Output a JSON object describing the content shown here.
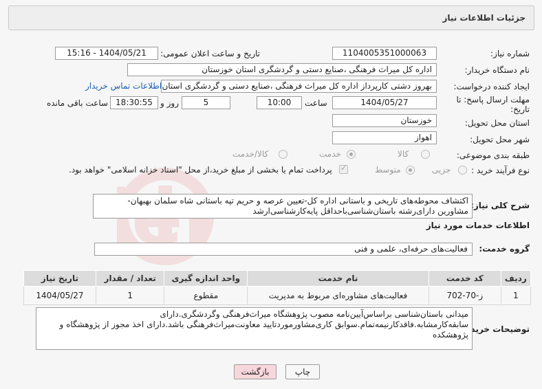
{
  "page_title": "جزئیات اطلاعات نیاز",
  "need_number": {
    "label": "شماره نیاز:",
    "value": "1104005351000063"
  },
  "announce": {
    "label": "تاریخ و ساعت اعلان عمومی:",
    "value": "1404/05/21 - 15:16"
  },
  "buyer_org": {
    "label": "نام دستگاه خریدار:",
    "value": "اداره کل میراث فرهنگی ،صنایع دستی و گردشگری استان خوزستان"
  },
  "requester": {
    "label": "ایجاد کننده درخواست:",
    "value": "بهروز دشتی کارپرداز اداره کل میراث فرهنگی ،صنایع دستی و گردشگری استان خوزستان",
    "contact_link": "اطلاعات تماس خریدار"
  },
  "deadline": {
    "label_line1": "مهلت ارسال پاسخ: تا",
    "label_line2": "تاریخ:",
    "date": "1404/05/27",
    "time_label": "ساعت",
    "time": "10:00",
    "days_label": "روز و",
    "days": "5",
    "remaining": "18:30:55",
    "remaining_label": "ساعت باقی مانده"
  },
  "province": {
    "label": "استان محل تحویل:",
    "value": "خوزستان"
  },
  "city": {
    "label": "شهر محل تحویل:",
    "value": "اهواز"
  },
  "category": {
    "label": "طبقه بندی موضوعی:",
    "options": [
      "کالا",
      "خدمت",
      "کالا/خدمت"
    ],
    "selected": "خدمت"
  },
  "process": {
    "label": "نوع فرآیند خرید :",
    "options": [
      "جزیی",
      "متوسط"
    ],
    "selected": "متوسط",
    "payment_note": "پرداخت تمام یا بخشی از مبلغ خرید،از محل \"اسناد خزانه اسلامی\" خواهد بود."
  },
  "summary": {
    "label": "شرح کلی نیاز:",
    "text": "اکتشاف محوطه‌های تاریخی و باستانی اداره کل-تعیین عرصه و حریم تپه باستانی شاه سلمان بهبهان-مشاورین دارای‌رشته باستان‌شناسی‌باحداقل پایه‌کارشناسی‌ارشد"
  },
  "services_title": "اطلاعات خدمات مورد نیاز",
  "service_group": {
    "label": "گروه خدمت:",
    "value": "فعالیت‌های حرفه‌ای، علمی و فنی"
  },
  "table": {
    "headers": [
      "ردیف",
      "کد خدمت",
      "نام خدمت",
      "واحد اندازه گیری",
      "تعداد / مقدار",
      "تاریخ نیاز"
    ],
    "rows": [
      [
        "1",
        "ز-70-702",
        "فعالیت‌های مشاوره‌ای مربوط به مدیریت",
        "مقطوع",
        "1",
        "1404/05/27"
      ]
    ]
  },
  "buyer_notes": {
    "label": "توضیحات خریدار:",
    "text": "میدانی باستان‌شناسی براساس‌آیین‌نامه مصوب پژوهشگاه میراث‌فرهنگی وگردشگری.دارای سابقه‌کارمشابه.فاقدکارنیمه‌تمام.سوابق کاری‌مشاورموردتایید معاونت‌میراث‌فرهنگی باشد.دارای اخذ مجوز از پژوهشگاه و پژوهشکده"
  },
  "buttons": {
    "print": "چاپ",
    "back": "بازگشت"
  },
  "colors": {
    "back_button_bg": "#f8d7dc",
    "link": "#1a5fb4",
    "header_bg": "#dcdcdc"
  }
}
